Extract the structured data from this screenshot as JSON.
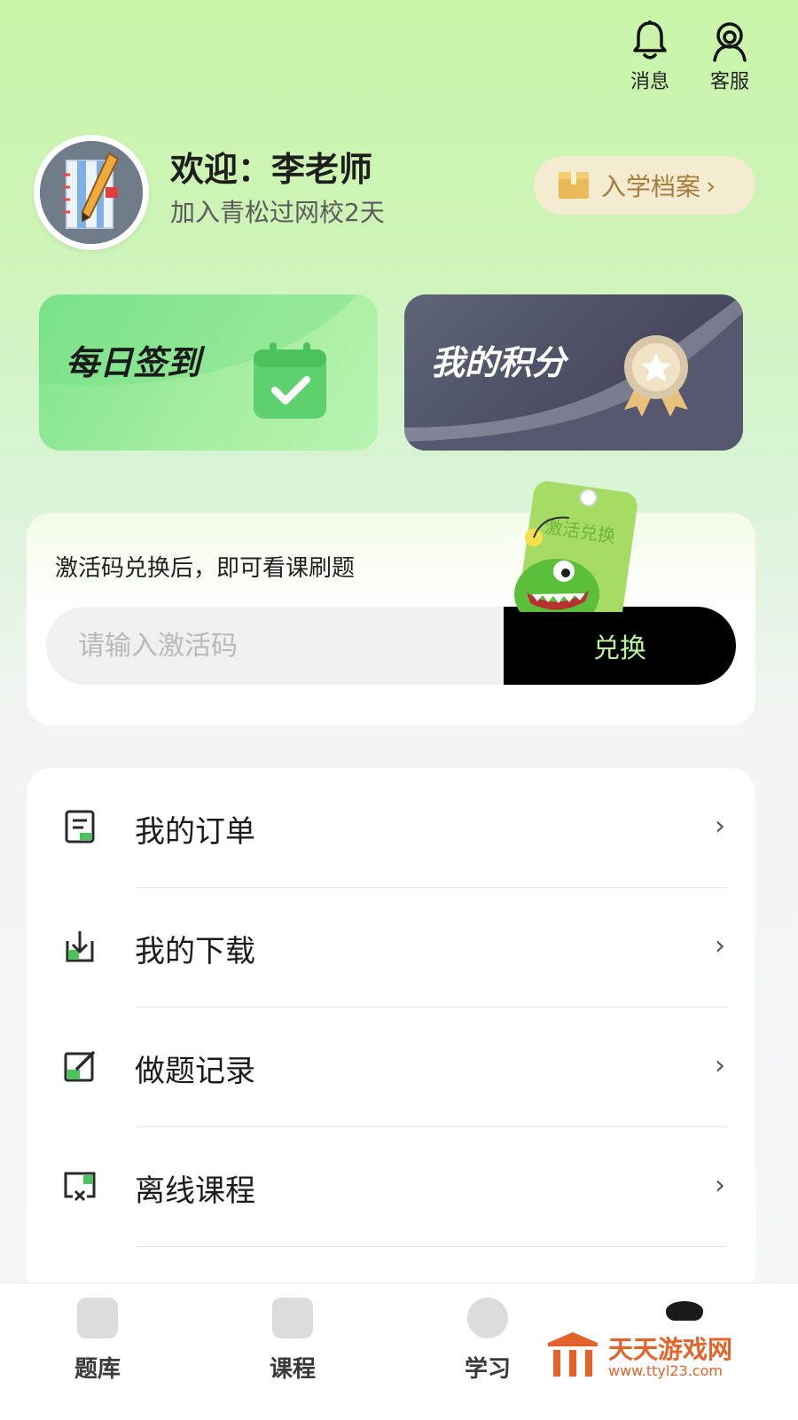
{
  "header": {
    "messages_label": "消息",
    "service_label": "客服"
  },
  "profile": {
    "welcome": "欢迎：李老师",
    "joined": "加入青松过网校2天",
    "archive_label": "入学档案",
    "archive_chevron": "›"
  },
  "cards": {
    "sign_in": "每日签到",
    "points": "我的积分"
  },
  "activation": {
    "hint": "激活码兑换后，即可看课刷题",
    "placeholder": "请输入激活码",
    "button": "兑换",
    "mascot_text": "激活兑换"
  },
  "menu": {
    "items": [
      {
        "label": "我的订单",
        "icon": "order-icon"
      },
      {
        "label": "我的下载",
        "icon": "download-icon"
      },
      {
        "label": "做题记录",
        "icon": "edit-record-icon"
      },
      {
        "label": "离线课程",
        "icon": "offline-course-icon"
      }
    ],
    "chevron": "›"
  },
  "tabbar": {
    "tabs": [
      {
        "label": "题库",
        "icon": "question-bank-icon"
      },
      {
        "label": "课程",
        "icon": "course-icon"
      },
      {
        "label": "学习",
        "icon": "study-icon"
      },
      {
        "label": "",
        "icon": "profile-icon"
      }
    ]
  },
  "watermark": {
    "name": "天天游戏网",
    "url": "www.ttyl23.com"
  },
  "colors": {
    "accent_green": "#b9f49a",
    "archive_text": "#a77c3c",
    "dark_card": "#494b60",
    "watermark": "#e3632a"
  }
}
